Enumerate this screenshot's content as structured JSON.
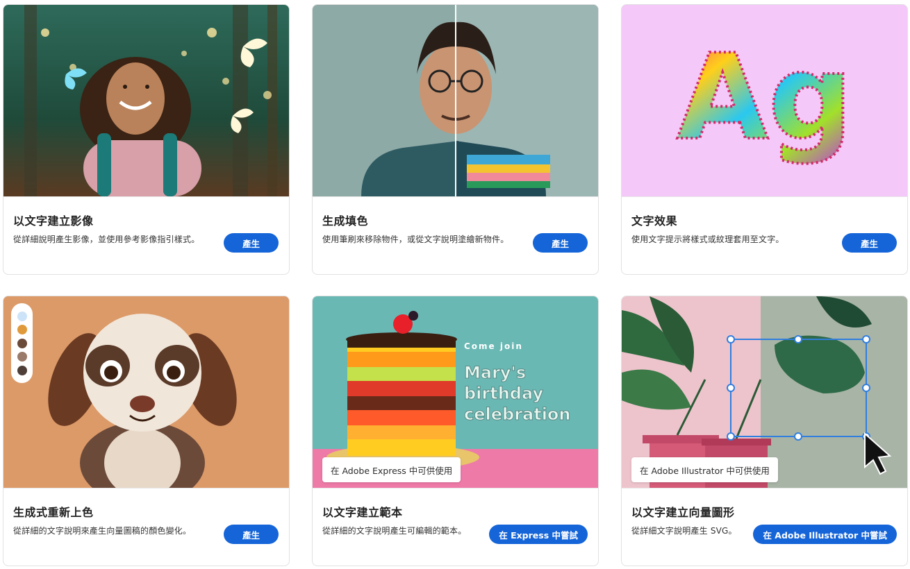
{
  "cards": [
    {
      "title": "以文字建立影像",
      "description": "從詳細說明產生影像，並使用參考影像指引樣式。",
      "button": "產生"
    },
    {
      "title": "生成填色",
      "description": "使用筆刷來移除物件，或從文字說明塗繪新物件。",
      "button": "產生"
    },
    {
      "title": "文字效果",
      "description": "使用文字提示將樣式或紋理套用至文字。",
      "button": "產生",
      "preview_text": "Ag"
    },
    {
      "title": "生成式重新上色",
      "description": "從詳細的文字說明來產生向量圖稿的顏色變化。",
      "button": "產生",
      "palette": [
        "#cde3f7",
        "#e09a3c",
        "#6b4a3a",
        "#9a7a68",
        "#4e3f38"
      ]
    },
    {
      "title": "以文字建立範本",
      "description": "從詳細的文字說明產生可編輯的範本。",
      "button": "在 Express 中嘗試",
      "badge": "在 Adobe Express 中可供使用",
      "poster": {
        "line1": "Come join",
        "line2": "Mary's",
        "line3": "birthday",
        "line4": "celebration"
      }
    },
    {
      "title": "以文字建立向量圖形",
      "description": "從詳細文字說明產生 SVG。",
      "button": "在 Adobe Illustrator 中嘗試",
      "badge": "在 Adobe Illustrator 中可供使用"
    }
  ],
  "colors": {
    "accent": "#1565d8",
    "card_border": "#e1e1e1",
    "text_effects_bg": "#f4c8f8",
    "recolor_bg": "#dc9a68"
  }
}
